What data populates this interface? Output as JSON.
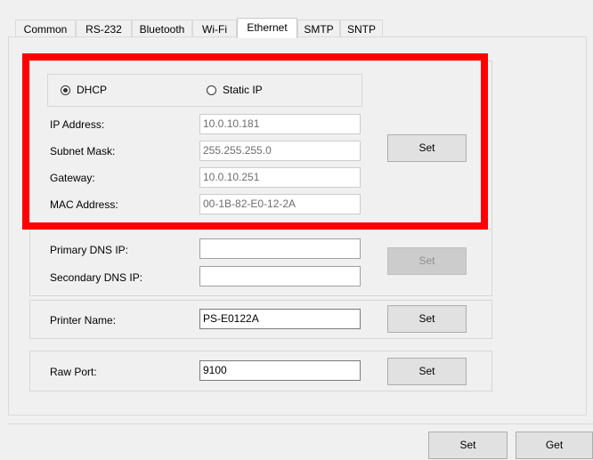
{
  "tabs": [
    {
      "label": "Common",
      "active": false
    },
    {
      "label": "RS-232",
      "active": false
    },
    {
      "label": "Bluetooth",
      "active": false
    },
    {
      "label": "Wi-Fi",
      "active": false
    },
    {
      "label": "Ethernet",
      "active": true
    },
    {
      "label": "SMTP",
      "active": false
    },
    {
      "label": "SNTP",
      "active": false
    }
  ],
  "ip_mode": {
    "dhcp_label": "DHCP",
    "static_label": "Static IP",
    "selected": "DHCP"
  },
  "network": {
    "ip_label": "IP Address:",
    "ip_value": "10.0.10.181",
    "subnet_label": "Subnet Mask:",
    "subnet_value": "255.255.255.0",
    "gateway_label": "Gateway:",
    "gateway_value": "10.0.10.251",
    "mac_label": "MAC Address:",
    "mac_value": "00-1B-82-E0-12-2A",
    "set_label": "Set"
  },
  "dns": {
    "primary_label": "Primary DNS IP:",
    "primary_value": "",
    "secondary_label": "Secondary DNS IP:",
    "secondary_value": "",
    "set_label": "Set"
  },
  "printer": {
    "name_label": "Printer Name:",
    "name_value": "PS-E0122A",
    "set_label": "Set"
  },
  "raw_port": {
    "label": "Raw Port:",
    "value": "9100",
    "set_label": "Set"
  },
  "footer": {
    "set_label": "Set",
    "get_label": "Get"
  },
  "colors": {
    "highlight": "#ff0000",
    "window_bg": "#f0f0f0"
  }
}
